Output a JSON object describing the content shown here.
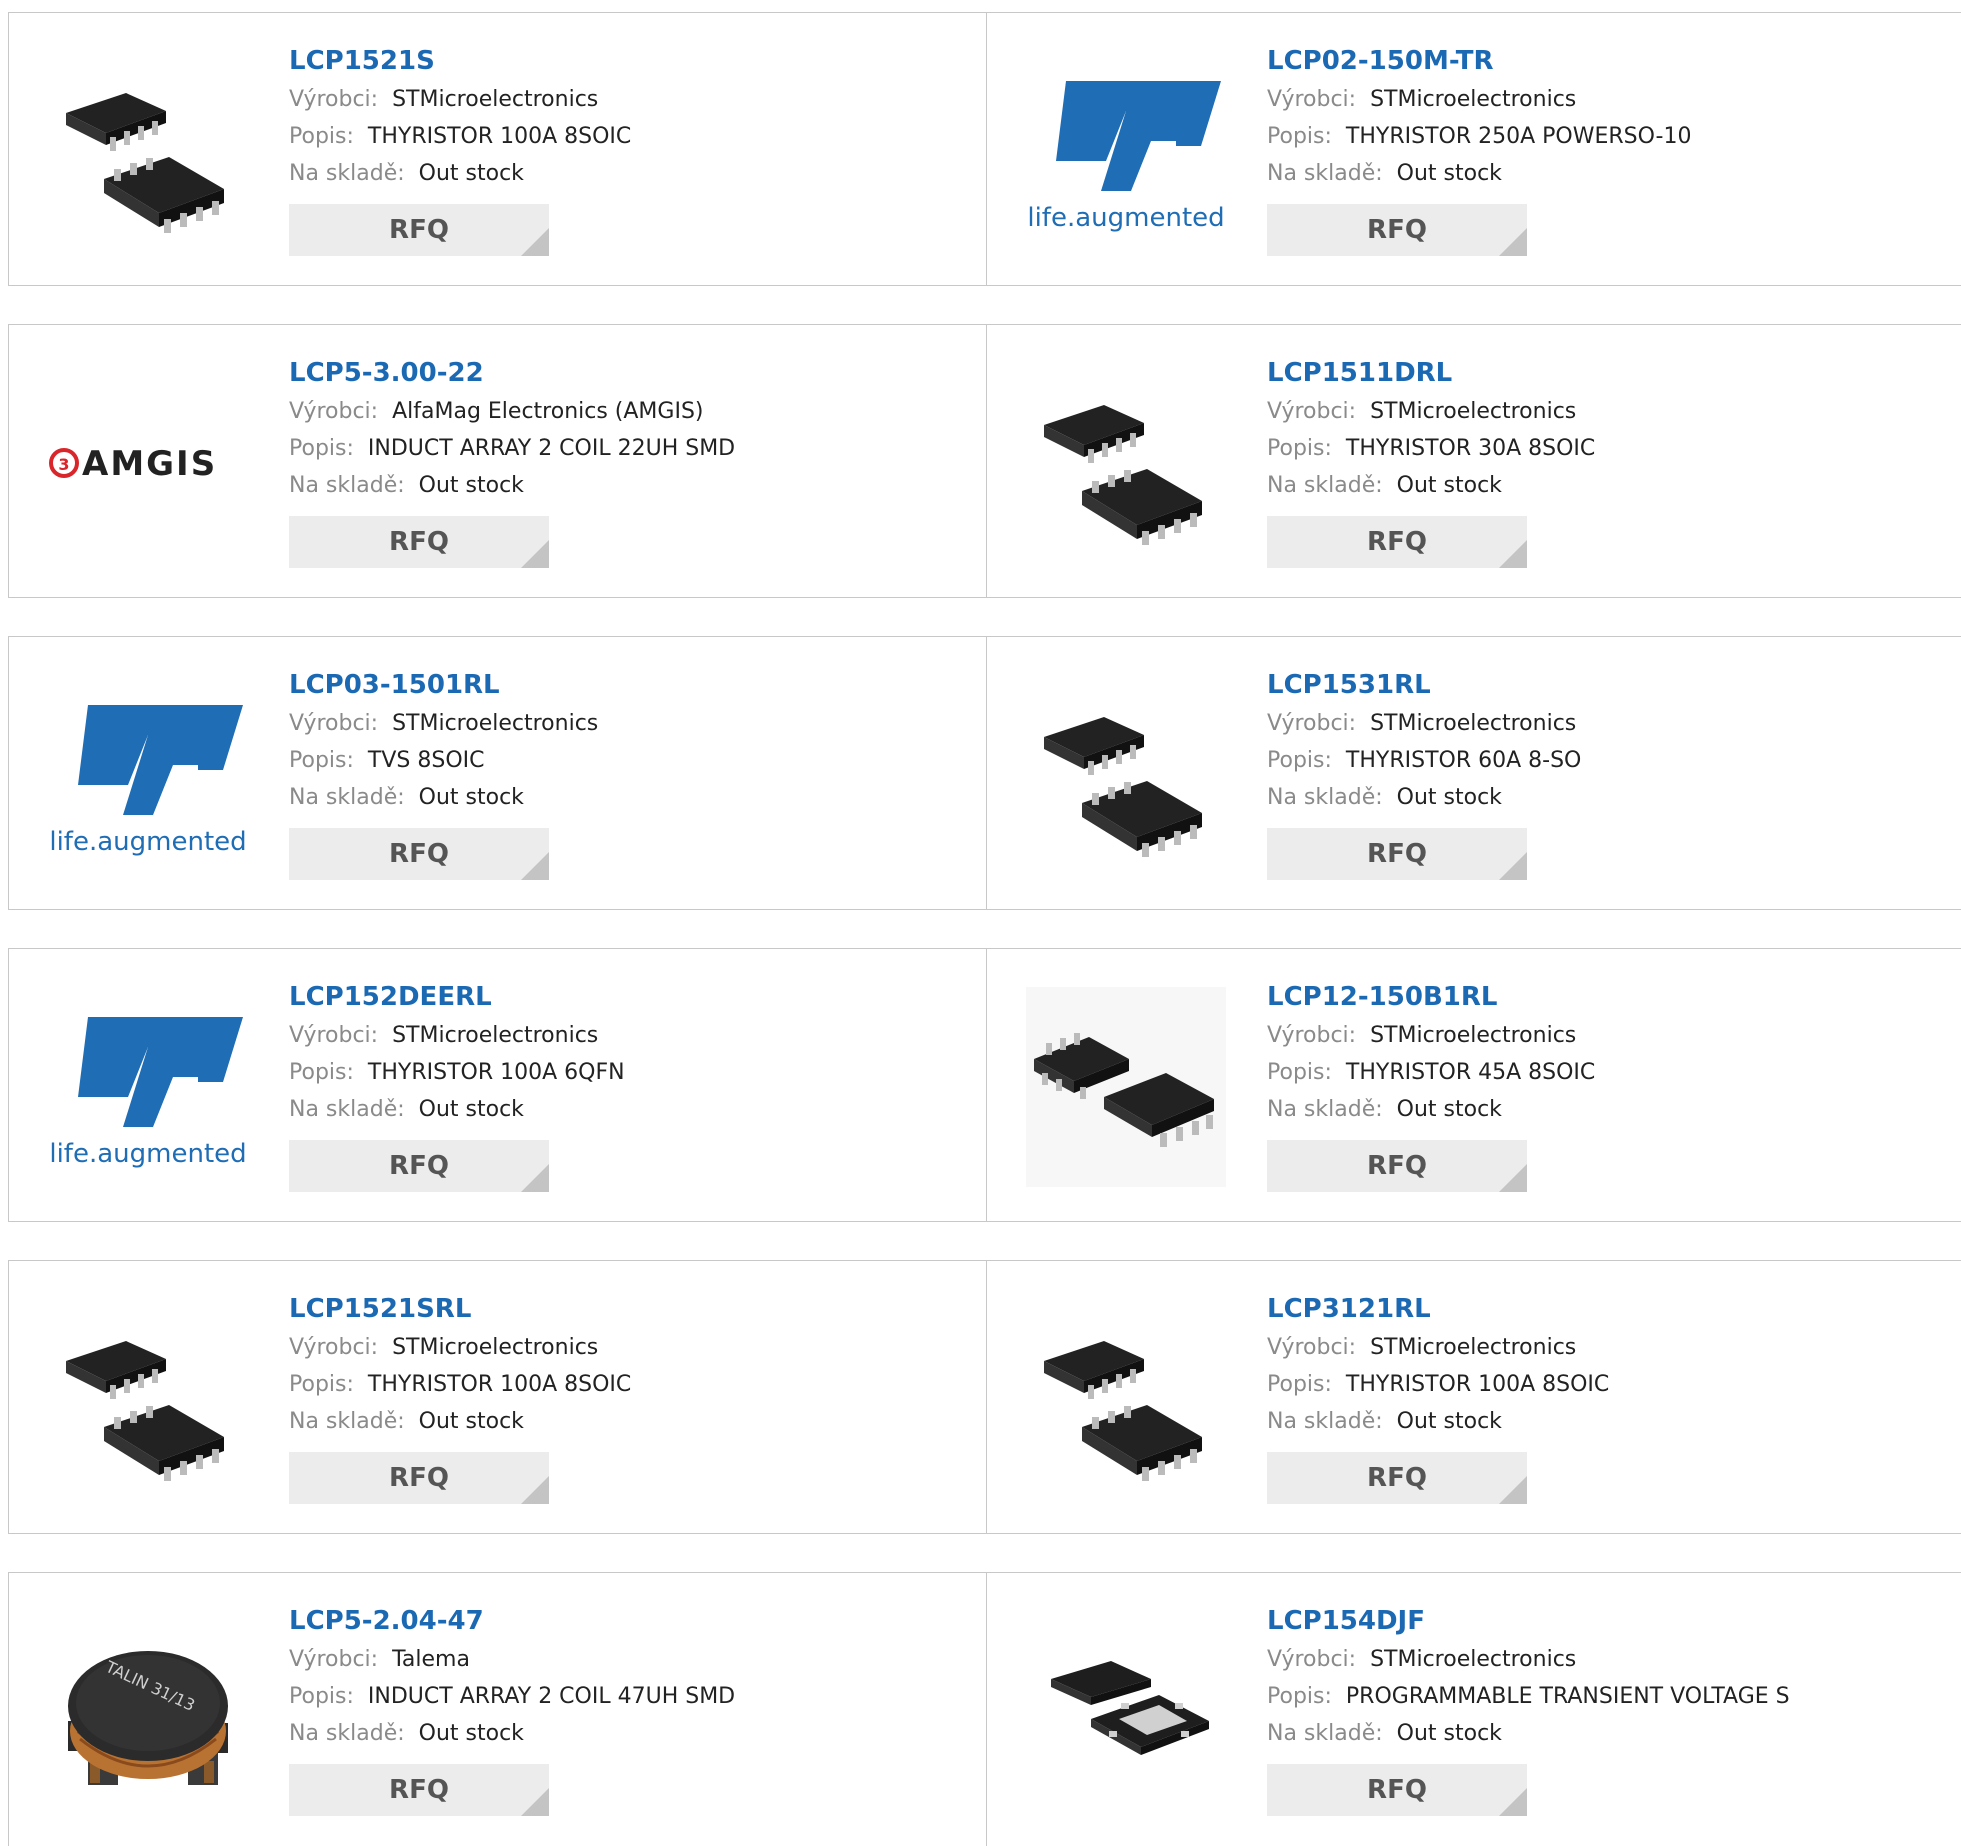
{
  "labels": {
    "manufacturer": "Výrobci:",
    "description": "Popis:",
    "stock": "Na skladě:",
    "rfq": "RFQ"
  },
  "rows": [
    [
      {
        "pn": "LCP1521S",
        "manufacturer": "STMicroelectronics",
        "description": "THYRISTOR 100A 8SOIC",
        "stock": "Out stock",
        "image": "soic8-pair-icon"
      },
      {
        "pn": "LCP02-150M-TR",
        "manufacturer": "STMicroelectronics",
        "description": "THYRISTOR 250A POWERSO-10",
        "stock": "Out stock",
        "image": "st-logo-icon"
      }
    ],
    [
      {
        "pn": "LCP5-3.00-22",
        "manufacturer": "AlfaMag Electronics (AMGIS)",
        "description": "INDUCT ARRAY 2 COIL 22UH SMD",
        "stock": "Out stock",
        "image": "amgis-logo-icon"
      },
      {
        "pn": "LCP1511DRL",
        "manufacturer": "STMicroelectronics",
        "description": "THYRISTOR 30A 8SOIC",
        "stock": "Out stock",
        "image": "soic8-pair-icon"
      }
    ],
    [
      {
        "pn": "LCP03-1501RL",
        "manufacturer": "STMicroelectronics",
        "description": "TVS 8SOIC",
        "stock": "Out stock",
        "image": "st-logo-icon"
      },
      {
        "pn": "LCP1531RL",
        "manufacturer": "STMicroelectronics",
        "description": "THYRISTOR 60A 8-SO",
        "stock": "Out stock",
        "image": "soic8-pair-icon"
      }
    ],
    [
      {
        "pn": "LCP152DEERL",
        "manufacturer": "STMicroelectronics",
        "description": "THYRISTOR 100A 6QFN",
        "stock": "Out stock",
        "image": "st-logo-icon"
      },
      {
        "pn": "LCP12-150B1RL",
        "manufacturer": "STMicroelectronics",
        "description": "THYRISTOR 45A 8SOIC",
        "stock": "Out stock",
        "image": "soic8-side-icon"
      }
    ],
    [
      {
        "pn": "LCP1521SRL",
        "manufacturer": "STMicroelectronics",
        "description": "THYRISTOR 100A 8SOIC",
        "stock": "Out stock",
        "image": "soic8-pair-icon"
      },
      {
        "pn": "LCP3121RL",
        "manufacturer": "STMicroelectronics",
        "description": "THYRISTOR 100A 8SOIC",
        "stock": "Out stock",
        "image": "soic8-pair-icon"
      }
    ],
    [
      {
        "pn": "LCP5-2.04-47",
        "manufacturer": "Talema",
        "description": "INDUCT ARRAY 2 COIL 47UH SMD",
        "stock": "Out stock",
        "image": "inductor-icon",
        "image_text": "TALIN 31/13"
      },
      {
        "pn": "LCP154DJF",
        "manufacturer": "STMicroelectronics",
        "description": "PROGRAMMABLE TRANSIENT VOLTAGE S",
        "stock": "Out stock",
        "image": "qfn-pair-icon"
      }
    ]
  ],
  "colors": {
    "link": "#1c69b3",
    "label": "#8a8a8a",
    "button_bg": "#ececec",
    "button_corner": "#c4c4c4",
    "st_blue": "#1f6db5",
    "amgis_red": "#d9262a"
  }
}
